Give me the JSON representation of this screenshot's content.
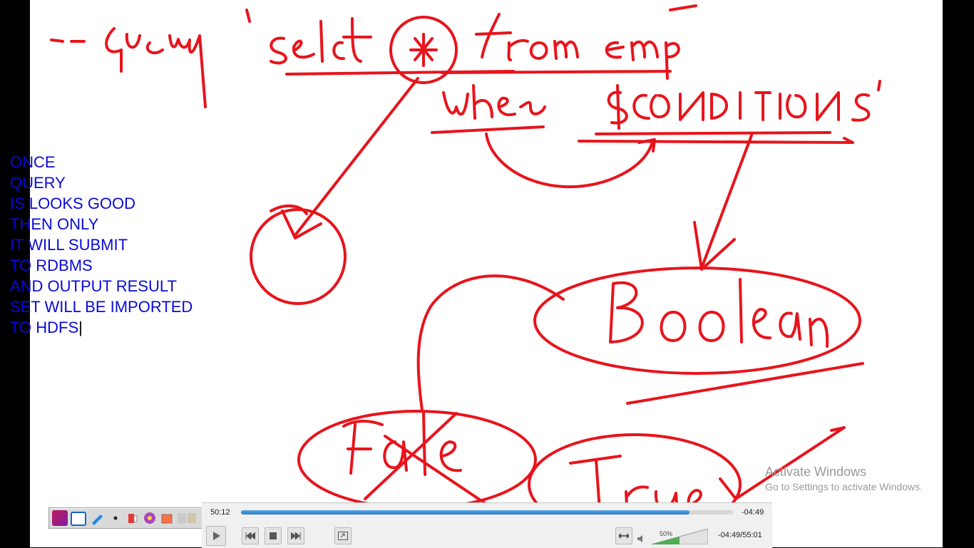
{
  "notes": {
    "lines": [
      "ONCE",
      "QUERY",
      "IS LOOKS GOOD",
      "THEN ONLY",
      "IT WILL SUBMIT",
      "TO RDBMS",
      "AND OUTPUT RESULT",
      "SET WILL BE IMPORTED",
      "TO HDFS"
    ]
  },
  "watermark": {
    "title": "Activate Windows",
    "subtitle": "Go to Settings to activate Windows."
  },
  "player": {
    "elapsed": "50:12",
    "remaining": "-04:49",
    "time_total": "-04:49/55:01",
    "volume_label": "50%",
    "progress": 0.912,
    "volume": 0.5
  },
  "icons": [
    "play-icon",
    "previous-icon",
    "stop-icon",
    "next-icon",
    "fullscreen-icon",
    "playlist-icon",
    "speaker-icon"
  ]
}
